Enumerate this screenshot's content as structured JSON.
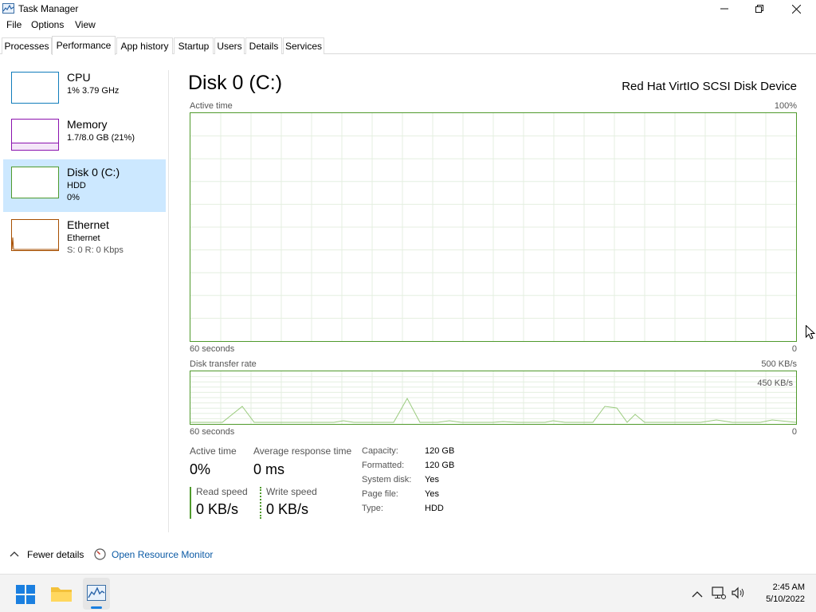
{
  "window": {
    "title": "Task Manager"
  },
  "menu": [
    "File",
    "Options",
    "View"
  ],
  "tabs": [
    "Processes",
    "Performance",
    "App history",
    "Startup",
    "Users",
    "Details",
    "Services"
  ],
  "sidebar": {
    "items": [
      {
        "title": "CPU",
        "line1": "1% 3.79 GHz",
        "line2": ""
      },
      {
        "title": "Memory",
        "line1": "1.7/8.0 GB (21%)",
        "line2": ""
      },
      {
        "title": "Disk 0 (C:)",
        "line1": "HDD",
        "line2": "0%"
      },
      {
        "title": "Ethernet",
        "line1": "Ethernet",
        "line2": "S: 0 R: 0 Kbps"
      }
    ]
  },
  "disk": {
    "title": "Disk 0 (C:)",
    "device": "Red Hat VirtIO SCSI Disk Device",
    "active_time_graph": {
      "label": "Active time",
      "max": "100%",
      "time": "60 seconds",
      "min": "0"
    },
    "transfer_graph": {
      "label": "Disk transfer rate",
      "max": "500 KB/s",
      "inner": "450 KB/s",
      "time": "60 seconds",
      "min": "0"
    },
    "stats": {
      "active_time_label": "Active time",
      "active_time_value": "0%",
      "avg_resp_label": "Average response time",
      "avg_resp_value": "0 ms",
      "read_label": "Read speed",
      "read_value": "0 KB/s",
      "write_label": "Write speed",
      "write_value": "0 KB/s"
    },
    "properties": [
      {
        "label": "Capacity:",
        "value": "120 GB"
      },
      {
        "label": "Formatted:",
        "value": "120 GB"
      },
      {
        "label": "System disk:",
        "value": "Yes"
      },
      {
        "label": "Page file:",
        "value": "Yes"
      },
      {
        "label": "Type:",
        "value": "HDD"
      }
    ]
  },
  "footer": {
    "fewer_details": "Fewer details",
    "resource_monitor": "Open Resource Monitor"
  },
  "taskbar": {
    "time": "2:45 AM",
    "date": "5/10/2022"
  },
  "colors": {
    "disk_green": "#4f9a2c",
    "memory_purple": "#8b12ae",
    "cpu_blue": "#117dbb",
    "ethernet_orange": "#a74f01",
    "selected_bg": "#cce8ff",
    "link_blue": "#0b5aa5"
  }
}
